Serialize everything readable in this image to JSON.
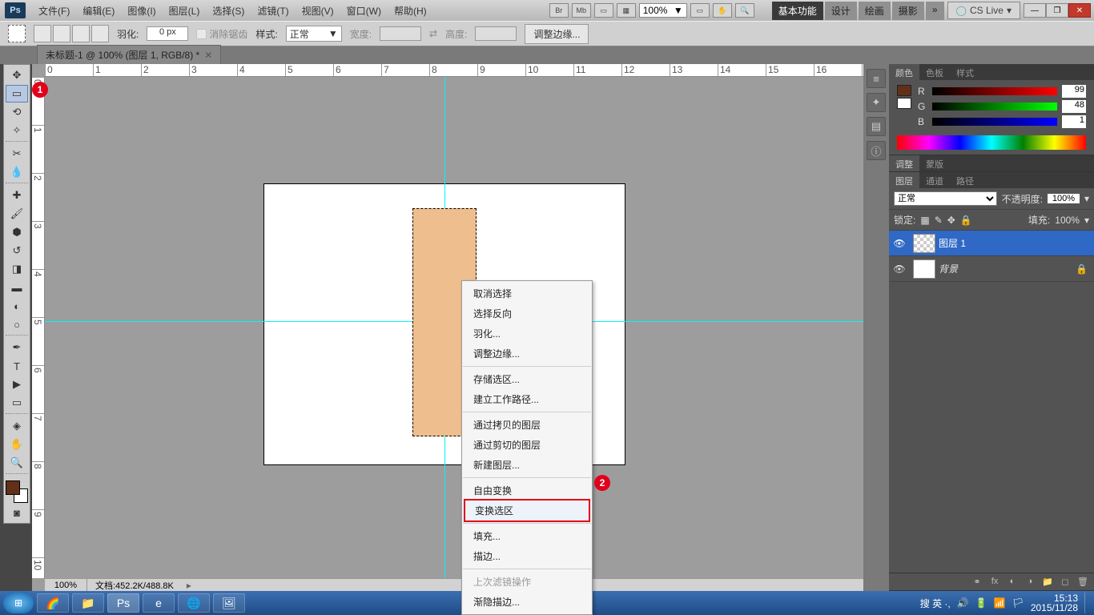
{
  "app": {
    "logo": "Ps",
    "cs_live": "CS Live",
    "zoom": "100%"
  },
  "menu": {
    "file": "文件(F)",
    "edit": "编辑(E)",
    "image": "图像(I)",
    "layer": "图层(L)",
    "select": "选择(S)",
    "filter": "滤镜(T)",
    "view": "视图(V)",
    "window": "窗口(W)",
    "help": "帮助(H)"
  },
  "workspace_tabs": {
    "essentials": "基本功能",
    "design": "设计",
    "painting": "绘画",
    "photo": "摄影",
    "more": "»"
  },
  "options": {
    "feather_label": "羽化:",
    "feather_value": "0 px",
    "antialias": "消除锯齿",
    "style_label": "样式:",
    "style_value": "正常",
    "width_label": "宽度:",
    "height_label": "高度:",
    "refine": "调整边缘..."
  },
  "doc": {
    "tab": "未标题-1 @ 100% (图层 1, RGB/8) *",
    "zoom": "100%",
    "info": "文档:452.2K/488.8K"
  },
  "color": {
    "tab1": "颜色",
    "tab2": "色板",
    "tab3": "样式",
    "r": "99",
    "g": "48",
    "b": "1"
  },
  "adjust": {
    "tab1": "调整",
    "tab2": "蒙版"
  },
  "layers": {
    "tab1": "图层",
    "tab2": "通道",
    "tab3": "路径",
    "mode": "正常",
    "opacity_label": "不透明度:",
    "opacity": "100%",
    "lock_label": "锁定:",
    "fill_label": "填充:",
    "fill": "100%",
    "layer1": "图层 1",
    "bg": "背景"
  },
  "ctx": {
    "deselect": "取消选择",
    "inverse": "选择反向",
    "feather": "羽化...",
    "refine": "调整边缘...",
    "save": "存储选区...",
    "workpath": "建立工作路径...",
    "copy": "通过拷贝的图层",
    "cut": "通过剪切的图层",
    "new": "新建图层...",
    "free": "自由变换",
    "transform": "变换选区",
    "fill": "填充...",
    "stroke": "描边...",
    "lastfilter": "上次滤镜操作",
    "fade": "渐隐描边..."
  },
  "taskbar": {
    "time": "15:13",
    "date": "2015/11/28",
    "ime": "搜 英 ·,"
  }
}
